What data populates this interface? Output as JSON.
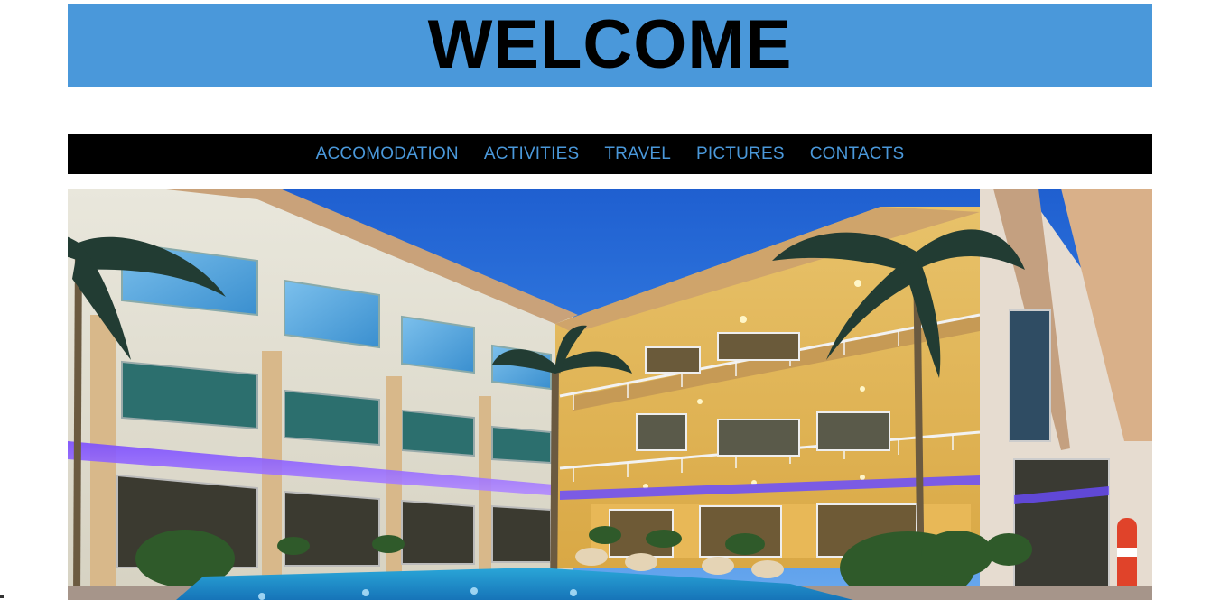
{
  "header": {
    "title": "WELCOME",
    "background_color": "#4a98da"
  },
  "nav": {
    "background_color": "#000000",
    "link_color": "#4a98da",
    "items": [
      {
        "label": "ACCOMODATION"
      },
      {
        "label": "ACTIVITIES"
      },
      {
        "label": "TRAVEL"
      },
      {
        "label": "PICTURES"
      },
      {
        "label": "CONTACTS"
      }
    ]
  },
  "hero": {
    "image_icon": "hotel-photo"
  }
}
